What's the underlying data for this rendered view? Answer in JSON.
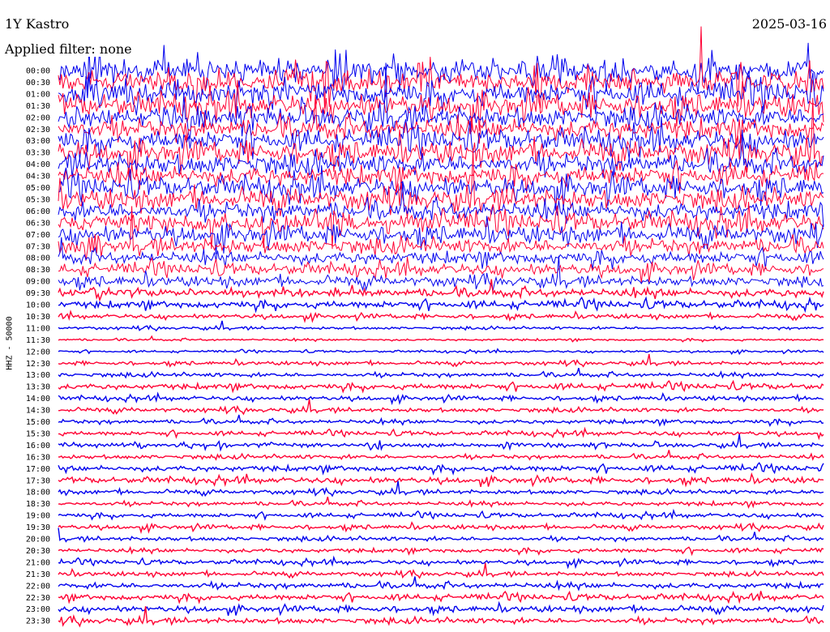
{
  "chart_data": {
    "type": "helicorder",
    "title": "1Y Kastro",
    "date": "2025-03-16",
    "filter_text": "Applied filter: none",
    "channel_label": "HHZ - 50000",
    "row_labels": [
      "00:00",
      "00:30",
      "01:00",
      "01:30",
      "02:00",
      "02:30",
      "03:00",
      "03:30",
      "04:00",
      "04:30",
      "05:00",
      "05:30",
      "06:00",
      "06:30",
      "07:00",
      "07:30",
      "08:00",
      "08:30",
      "09:00",
      "09:30",
      "10:00",
      "10:30",
      "11:00",
      "11:30",
      "12:00",
      "12:30",
      "13:00",
      "13:30",
      "14:00",
      "14:30",
      "15:00",
      "15:30",
      "16:00",
      "16:30",
      "17:00",
      "17:30",
      "18:00",
      "18:30",
      "19:00",
      "19:30",
      "20:00",
      "20:30",
      "21:00",
      "21:30",
      "22:00",
      "22:30",
      "23:00",
      "23:30"
    ],
    "colors": [
      "#0000ee",
      "#ff0033"
    ],
    "relative_amplitude": [
      16,
      16,
      16,
      16,
      15,
      15,
      15,
      15,
      15,
      14,
      14,
      14,
      13,
      13,
      12,
      11,
      9,
      8,
      7,
      6,
      5,
      3,
      2,
      1.5,
      1.5,
      2.5,
      3,
      4,
      3,
      3,
      3,
      3,
      3,
      3,
      4,
      4,
      3,
      3,
      3,
      3,
      3,
      3,
      3,
      3,
      4,
      4,
      4,
      4
    ]
  }
}
